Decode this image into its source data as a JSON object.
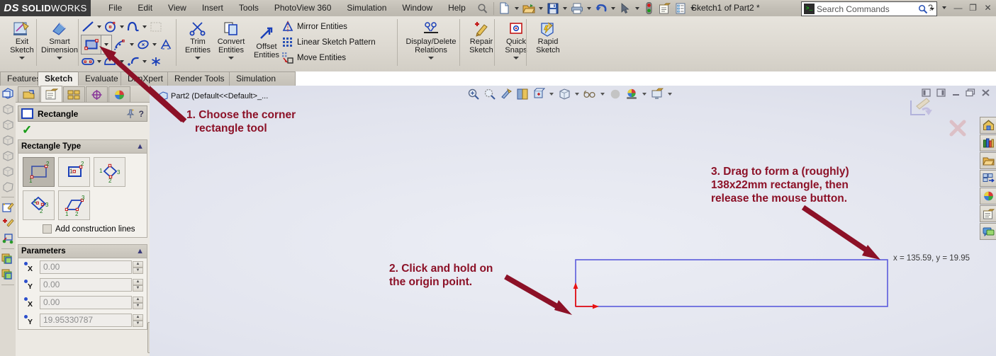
{
  "titlebar": {
    "logo_ds": "DS",
    "logo_solid": "SOLID",
    "logo_works": "WORKS",
    "menu": [
      "File",
      "Edit",
      "View",
      "Insert",
      "Tools",
      "PhotoView 360",
      "Simulation",
      "Window",
      "Help"
    ],
    "doc_title": "Sketch1 of Part2 *",
    "search_placeholder": "Search Commands",
    "quick_icons": [
      "new-document-icon",
      "open-folder-icon",
      "save-icon",
      "print-icon",
      "undo-icon",
      "select-cursor-icon",
      "rebuild-icon",
      "options-icon",
      "file-properties-icon"
    ],
    "help_icon": "help-icon",
    "minimize": "—",
    "restore": "❐",
    "close": "✕"
  },
  "ribbon": {
    "exit_sketch": "Exit\nSketch",
    "exit_sketch_l1": "Exit",
    "exit_sketch_l2": "Sketch",
    "smart_dimension_l1": "Smart",
    "smart_dimension_l2": "Dimension",
    "trim_l1": "Trim",
    "trim_l2": "Entities",
    "convert_l1": "Convert",
    "convert_l2": "Entities",
    "offset_l1": "Offset",
    "offset_l2": "Entities",
    "mirror_entities": "Mirror Entities",
    "linear_sketch_pattern": "Linear Sketch Pattern",
    "move_entities": "Move Entities",
    "display_delete_l1": "Display/Delete",
    "display_delete_l2": "Relations",
    "repair_l1": "Repair",
    "repair_l2": "Sketch",
    "quick_snaps_l1": "Quick",
    "quick_snaps_l2": "Snaps",
    "rapid_sketch_l1": "Rapid",
    "rapid_sketch_l2": "Sketch",
    "sketch_tools": [
      "line-icon",
      "circle-icon",
      "spline-icon",
      "surface-icon",
      "corner-rectangle-icon",
      "polygon-icon",
      "ellipse-icon",
      "text-icon",
      "slot-icon",
      "spline-on-surface-icon",
      "fillet-icon",
      "point-icon"
    ]
  },
  "tabs": {
    "items": [
      "Features",
      "Sketch",
      "Evaluate",
      "DimXpert",
      "Render Tools",
      "Simulation"
    ],
    "active": "Sketch"
  },
  "left_strip": {
    "icons": [
      "part-icon",
      "plane-front-icon",
      "plane-top-icon",
      "plane-right-icon",
      "plane-icon-4",
      "plane-icon-5",
      "origin-icon",
      "sketch-new-icon",
      "sketch-edit-icon",
      "3d-sketch-icon",
      "configuration-icon",
      "display-state-icon"
    ]
  },
  "property_manager": {
    "tabs": [
      "feature-manager-tab",
      "property-manager-tab",
      "configuration-manager-tab",
      "dimxpert-manager-tab",
      "appearances-tab"
    ],
    "title": "Rectangle",
    "pin_icon": "pin-icon",
    "help_icon": "help-icon",
    "ok_icon": "green-check-icon",
    "rectangle_type": {
      "header": "Rectangle Type",
      "options": [
        {
          "name": "corner-rectangle",
          "selected": true
        },
        {
          "name": "center-rectangle",
          "selected": false
        },
        {
          "name": "3-point-corner-rectangle",
          "selected": false
        },
        {
          "name": "3-point-center-rectangle",
          "selected": false
        },
        {
          "name": "parallelogram",
          "selected": false
        }
      ],
      "add_construction_lines": "Add construction lines",
      "add_construction_checked": false
    },
    "parameters": {
      "header": "Parameters",
      "fields": [
        {
          "axis": "X",
          "value": "0.00"
        },
        {
          "axis": "Y",
          "value": "0.00"
        },
        {
          "axis": "X",
          "value": "0.00"
        },
        {
          "axis": "Y",
          "value": "19.95330787"
        }
      ]
    }
  },
  "viewport": {
    "tree_label": "Part2  (Default<<Default>_...",
    "toolbar_icons": [
      "zoom-to-fit-icon",
      "zoom-to-area-icon",
      "previous-view-icon",
      "section-view-icon",
      "view-orientation-icon",
      "display-style-icon",
      "hide-show-icon",
      "edit-appearance-icon",
      "apply-scene-icon",
      "view-settings-icon"
    ],
    "window_controls": [
      "restore-left-icon",
      "restore-right-icon",
      "minimize-icon",
      "restore-icon",
      "close-icon"
    ],
    "coordinate_readout": "x = 135.59, y = 19.95",
    "callouts": [
      {
        "id": "callout-1",
        "text": "1. Choose the corner\nrectangle tool",
        "line1": "1. Choose the corner",
        "line2": "rectangle tool"
      },
      {
        "id": "callout-2",
        "text": "2. Click and hold on\nthe origin point.",
        "line1": "2. Click and hold on",
        "line2": "the origin point."
      },
      {
        "id": "callout-3",
        "text": "3. Drag to form a (roughly)\n138x22mm rectangle, then\nrelease the mouse button.",
        "line1": "3. Drag to form a (roughly)",
        "line2": "138x22mm rectangle, then",
        "line3": "release the mouse button."
      }
    ],
    "sketch_rect": {
      "name": "sketch-rectangle",
      "stroke": "#5b5bdc"
    },
    "origin": {
      "name": "origin-marker",
      "color": "#e81313"
    },
    "task_pane_icons": [
      "solidworks-resources-icon",
      "design-library-icon",
      "file-explorer-icon",
      "view-palette-icon",
      "appearances-scenes-icon",
      "custom-properties-icon",
      "solidworks-forum-icon"
    ]
  },
  "colors": {
    "annotation_red": "#8c1127",
    "sketch_blue": "#5b5bdc",
    "origin_red": "#e81313",
    "accent_dark": "#3b3b3b"
  }
}
